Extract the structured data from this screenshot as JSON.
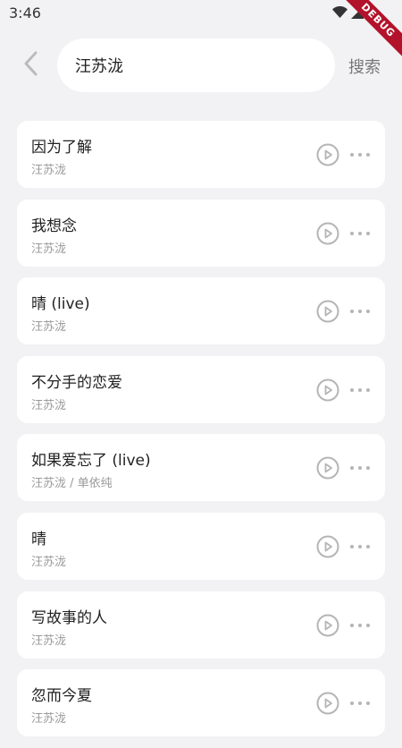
{
  "status_bar": {
    "time": "3:46",
    "icons": [
      "wifi-icon",
      "cell-signal-icon",
      "battery-icon"
    ]
  },
  "debug_banner": "DEBUG",
  "search": {
    "query": "汪苏泷",
    "button_label": "搜索"
  },
  "songs": [
    {
      "title": "因为了解",
      "artist": "汪苏泷"
    },
    {
      "title": "我想念",
      "artist": "汪苏泷"
    },
    {
      "title": "晴 (live)",
      "artist": "汪苏泷"
    },
    {
      "title": "不分手的恋爱",
      "artist": "汪苏泷"
    },
    {
      "title": "如果爱忘了 (live)",
      "artist": "汪苏泷 / 单依纯"
    },
    {
      "title": "晴",
      "artist": "汪苏泷"
    },
    {
      "title": "写故事的人",
      "artist": "汪苏泷"
    },
    {
      "title": "忽而今夏",
      "artist": "汪苏泷"
    }
  ],
  "colors": {
    "background": "#f2f2f4",
    "card": "#ffffff",
    "icon_gray": "#b5b5b5",
    "debug_ribbon": "#b2132b"
  }
}
